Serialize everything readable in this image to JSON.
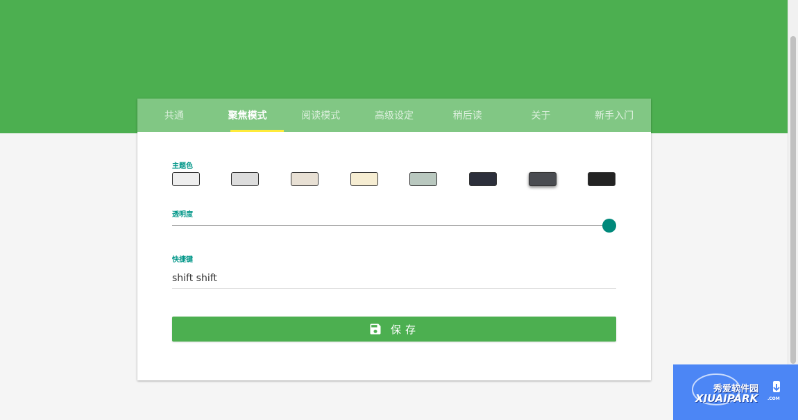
{
  "tabs": [
    {
      "label": "共通"
    },
    {
      "label": "聚焦模式"
    },
    {
      "label": "阅读模式"
    },
    {
      "label": "高级设定"
    },
    {
      "label": "稍后读"
    },
    {
      "label": "关于"
    },
    {
      "label": "新手入门"
    }
  ],
  "active_tab": "聚焦模式",
  "theme": {
    "label": "主题色",
    "swatches": [
      "#eeeeee",
      "#dcdcdc",
      "#e8e0d4",
      "#f6edd2",
      "#b9c8bf",
      "#2c2f3b",
      "#4a4c51",
      "#232323"
    ],
    "selected_index": 6
  },
  "opacity": {
    "label": "透明度",
    "value": 1.0
  },
  "shortcut": {
    "label": "快捷键",
    "value": "shift shift"
  },
  "save_button": {
    "label": "保存",
    "icon": "floppy-disk-icon"
  },
  "colors": {
    "header": "#4caf50",
    "tabs_bg": "#81c784",
    "tab_indicator": "#ffeb3b",
    "accent": "#009688",
    "button": "#4caf50"
  },
  "watermark": {
    "title": "秀爱软件园",
    "brand": "XIUAIPARK",
    "suffix": ".COM"
  }
}
